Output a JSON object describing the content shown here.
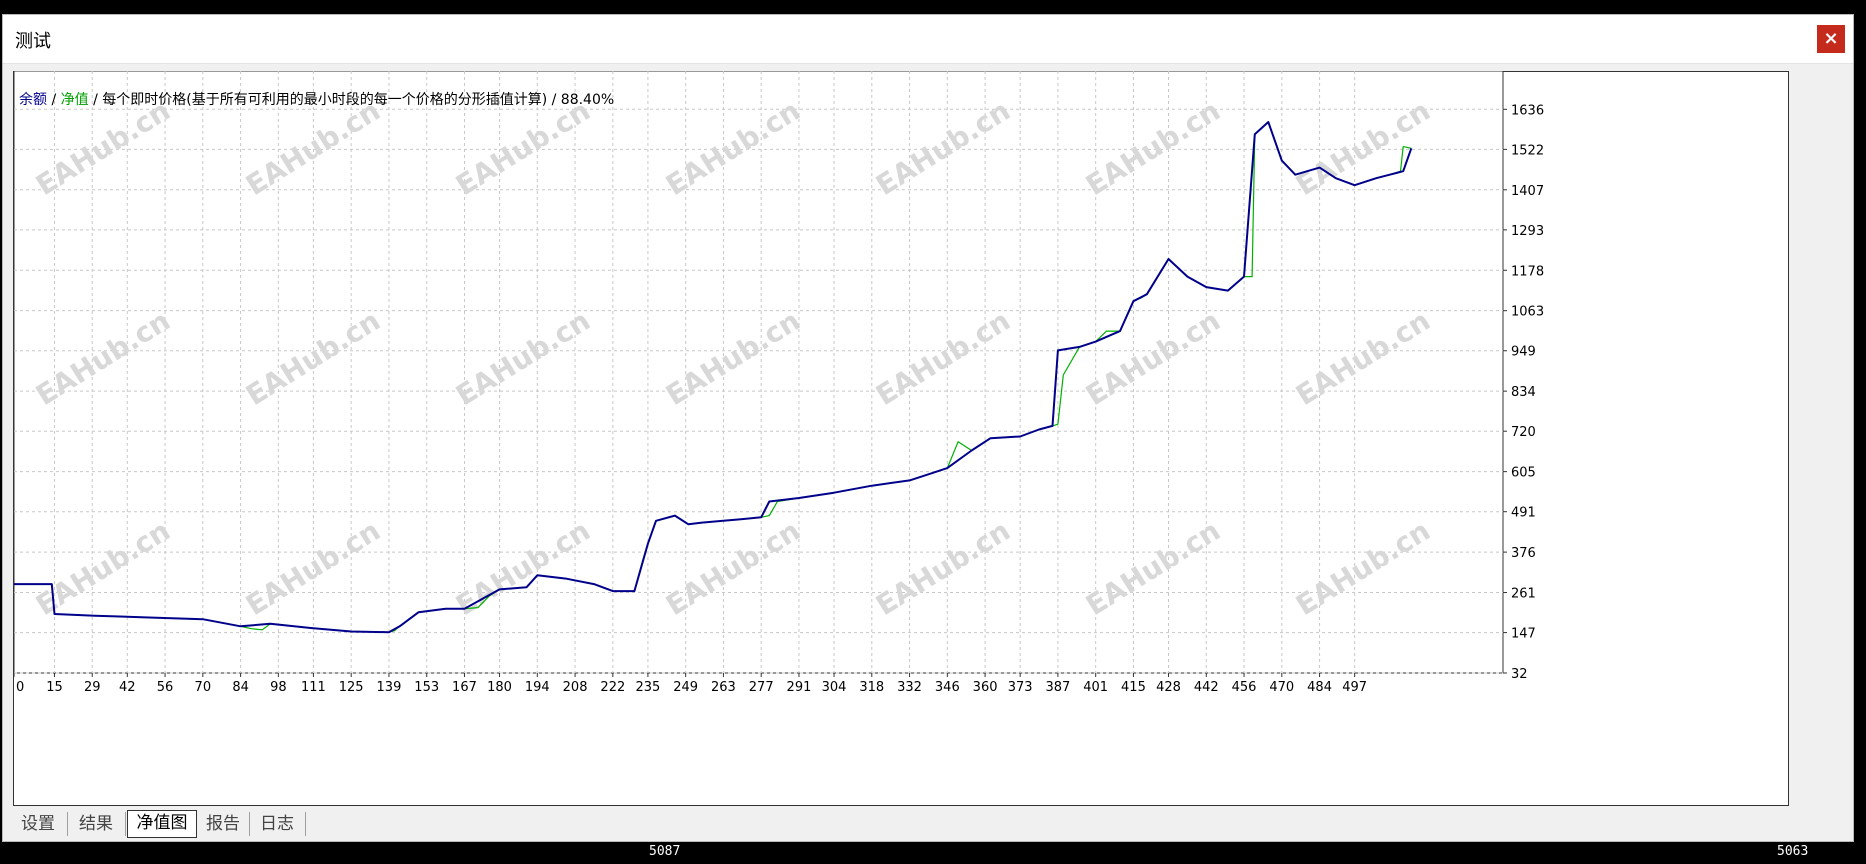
{
  "window": {
    "title": "测试",
    "close_label": "×"
  },
  "legend": {
    "balance_label": "余额",
    "sep1": " / ",
    "equity_label": "净值",
    "description": " / 每个即时价格(基于所有可利用的最小时段的每一个价格的分形插值计算) / 88.40%"
  },
  "tabs": [
    {
      "label": "设置",
      "active": false
    },
    {
      "label": "结果",
      "active": false
    },
    {
      "label": "净值图",
      "active": true
    },
    {
      "label": "报告",
      "active": false
    },
    {
      "label": "日志",
      "active": false
    }
  ],
  "background_labels": {
    "left": "5087",
    "right": "5063"
  },
  "watermark_text": "EAHub.cn",
  "colors": {
    "balance": "#00008b",
    "equity": "#00b000",
    "grid": "#c8c8c8",
    "close": "#c42b1c"
  },
  "chart_data": {
    "type": "line",
    "x_ticks": [
      0,
      15,
      29,
      42,
      56,
      70,
      84,
      98,
      111,
      125,
      139,
      153,
      167,
      180,
      194,
      208,
      222,
      235,
      249,
      263,
      277,
      291,
      304,
      318,
      332,
      346,
      360,
      373,
      387,
      401,
      415,
      428,
      442,
      456,
      470,
      484,
      497
    ],
    "y_ticks": [
      32,
      147,
      261,
      376,
      491,
      605,
      720,
      834,
      949,
      1063,
      1178,
      1293,
      1407,
      1522,
      1636
    ],
    "xlim": [
      0,
      552
    ],
    "ylim": [
      32,
      1745
    ],
    "grid": true,
    "series": [
      {
        "name": "余额",
        "color": "#00008b",
        "x": [
          0,
          14,
          15,
          30,
          50,
          70,
          84,
          95,
          110,
          125,
          139,
          143,
          150,
          160,
          167,
          180,
          190,
          194,
          205,
          215,
          222,
          230,
          235,
          238,
          245,
          250,
          255,
          263,
          270,
          277,
          280,
          291,
          304,
          318,
          332,
          340,
          346,
          355,
          362,
          373,
          380,
          385,
          387,
          395,
          401,
          410,
          415,
          420,
          428,
          435,
          442,
          450,
          456,
          460,
          465,
          470,
          475,
          484,
          490,
          497,
          505,
          510,
          515,
          518
        ],
        "values": [
          285,
          285,
          200,
          195,
          190,
          185,
          165,
          172,
          160,
          150,
          148,
          165,
          205,
          215,
          215,
          270,
          276,
          310,
          300,
          285,
          265,
          265,
          400,
          465,
          480,
          455,
          460,
          465,
          470,
          475,
          520,
          530,
          545,
          565,
          580,
          600,
          615,
          665,
          700,
          705,
          725,
          735,
          950,
          960,
          975,
          1005,
          1090,
          1110,
          1210,
          1160,
          1130,
          1120,
          1160,
          1565,
          1600,
          1490,
          1450,
          1470,
          1440,
          1420,
          1440,
          1450,
          1460,
          1525
        ]
      },
      {
        "name": "净值",
        "color": "#00b000",
        "x": [
          0,
          14,
          15,
          30,
          50,
          70,
          84,
          88,
          92,
          95,
          110,
          125,
          139,
          141,
          143,
          150,
          160,
          167,
          172,
          176,
          180,
          190,
          194,
          205,
          215,
          222,
          230,
          233,
          235,
          238,
          245,
          250,
          255,
          263,
          270,
          277,
          280,
          283,
          291,
          304,
          318,
          332,
          340,
          346,
          350,
          355,
          362,
          373,
          380,
          385,
          387,
          389,
          395,
          401,
          405,
          410,
          415,
          418,
          420,
          428,
          435,
          442,
          450,
          456,
          459,
          460,
          465,
          470,
          475,
          484,
          490,
          497,
          505,
          510,
          514,
          515,
          518
        ],
        "values": [
          285,
          285,
          200,
          195,
          190,
          185,
          165,
          158,
          155,
          172,
          160,
          150,
          148,
          152,
          165,
          205,
          215,
          215,
          218,
          250,
          270,
          276,
          310,
          300,
          285,
          265,
          265,
          350,
          400,
          465,
          480,
          455,
          460,
          465,
          470,
          475,
          480,
          520,
          530,
          545,
          565,
          580,
          600,
          615,
          690,
          665,
          700,
          705,
          725,
          735,
          740,
          880,
          960,
          975,
          1005,
          1005,
          1090,
          1100,
          1110,
          1210,
          1160,
          1130,
          1120,
          1160,
          1160,
          1565,
          1600,
          1490,
          1450,
          1470,
          1440,
          1420,
          1440,
          1450,
          1460,
          1530,
          1525
        ]
      }
    ]
  }
}
